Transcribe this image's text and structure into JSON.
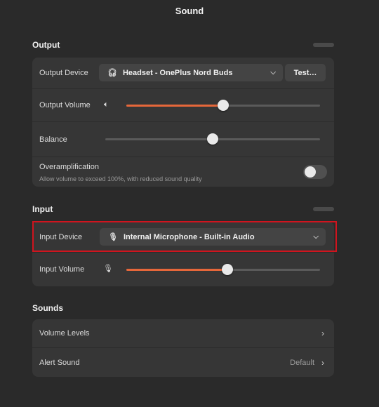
{
  "window": {
    "title": "Sound"
  },
  "output": {
    "header": "Output",
    "device_label": "Output Device",
    "device_value": "Headset - OnePlus Nord Buds",
    "device_icon": "headphones-icon",
    "test_button": "Test…",
    "volume_label": "Output Volume",
    "volume_level_percent": 50,
    "balance_label": "Balance",
    "balance_level_percent": 50,
    "overamp_label": "Overamplification",
    "overamp_description": "Allow volume to exceed 100%, with reduced sound quality",
    "overamp_enabled": false
  },
  "input": {
    "header": "Input",
    "device_label": "Input Device",
    "device_value": "Internal Microphone - Built-in Audio",
    "device_icon": "microphone-icon",
    "volume_label": "Input Volume",
    "volume_level_percent": 52
  },
  "sounds": {
    "header": "Sounds",
    "volume_levels_label": "Volume Levels",
    "alert_sound_label": "Alert Sound",
    "alert_sound_value": "Default"
  },
  "colors": {
    "accent": "#e6673a",
    "highlight": "#d0141e"
  }
}
